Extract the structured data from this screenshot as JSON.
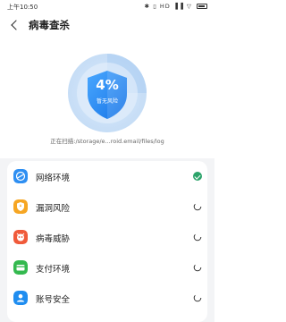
{
  "status_bar": {
    "time": "上午10:50",
    "icons": [
      "bluetooth-icon",
      "vibrate-icon",
      "hd-icon",
      "signal-icon",
      "wifi-icon",
      "battery-icon"
    ],
    "icon_text": "✱ ▯ HD ▐▐ ▽"
  },
  "header": {
    "title": "病毒查杀"
  },
  "scan": {
    "percent": "4%",
    "risk_label": "暂无风险",
    "path_text": "正在扫描:/storage/e...roid.email/files/log",
    "progress": 0.04
  },
  "checks": [
    {
      "label": "网络环境",
      "icon": "globe-icon",
      "icon_color": "#2e8ff2",
      "status": "done"
    },
    {
      "label": "漏洞风险",
      "icon": "shield-icon",
      "icon_color": "#f6a623",
      "status": "scanning"
    },
    {
      "label": "病毒威胁",
      "icon": "virus-icon",
      "icon_color": "#f05a3a",
      "status": "scanning"
    },
    {
      "label": "支付环境",
      "icon": "wallet-icon",
      "icon_color": "#34b94f",
      "status": "scanning"
    },
    {
      "label": "账号安全",
      "icon": "user-icon",
      "icon_color": "#1f8df0",
      "status": "scanning"
    }
  ],
  "colors": {
    "accent": "#2e8ff2",
    "success": "#2ca36a"
  }
}
